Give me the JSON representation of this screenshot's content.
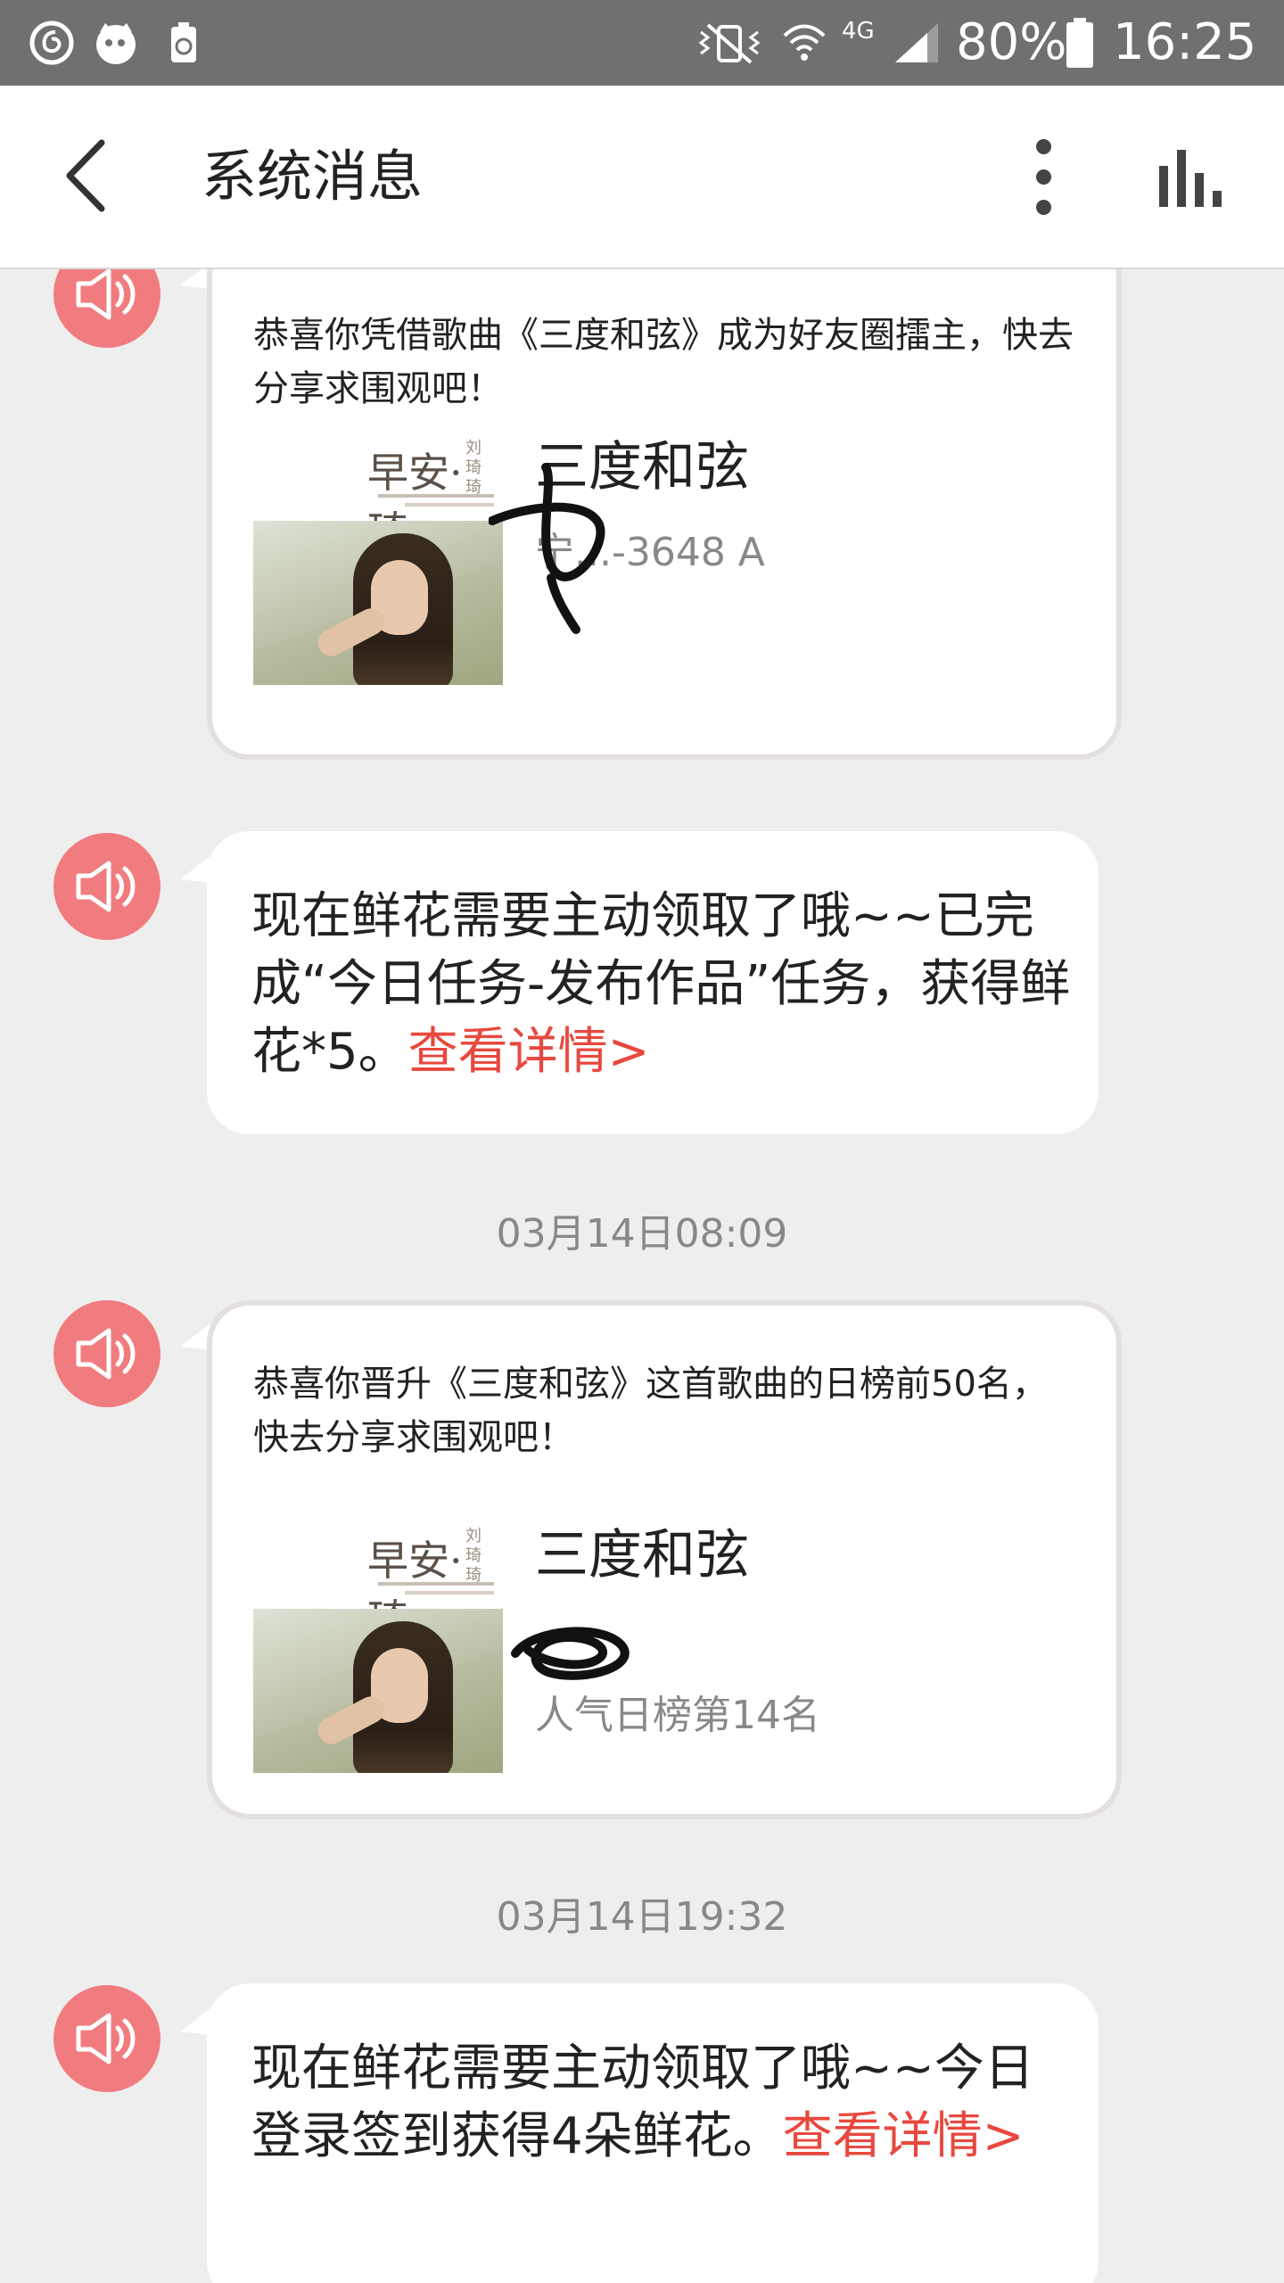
{
  "status_bar": {
    "battery_percent": "80%",
    "time": "16:25",
    "network_label": "4G",
    "left_icons": [
      "netease-music-icon",
      "cat-app-icon",
      "battery-saver-icon"
    ],
    "right_icons": [
      "mute-vibrate-icon",
      "wifi-icon",
      "cell-signal-icon",
      "battery-icon"
    ]
  },
  "header": {
    "title": "系统消息",
    "back_icon": "chevron-left-icon",
    "more_icon": "more-vertical-icon",
    "playing_icon": "equalizer-icon"
  },
  "messages": [
    {
      "type": "card",
      "text": "恭喜你凭借歌曲《三度和弦》成为好友圈擂主，快去分享求围观吧！",
      "song": {
        "cover_brand": "早安·琦",
        "cover_sub": "刘琦琦",
        "title": "三度和弦",
        "artist": "宁...-3648 A"
      }
    },
    {
      "type": "text",
      "text": "现在鲜花需要主动领取了哦~~已完成“今日任务-发布作品”任务，获得鲜花*5。",
      "link": "查看详情>"
    },
    {
      "type": "card",
      "timestamp": "03月14日08:09",
      "text": "恭喜你晋升《三度和弦》这首歌曲的日榜前50名，快去分享求围观吧！",
      "song": {
        "cover_brand": "早安·琦",
        "cover_sub": "刘琦琦",
        "title": "三度和弦",
        "rank": "人气日榜第14名"
      }
    },
    {
      "type": "text",
      "timestamp": "03月14日19:32",
      "text": "现在鲜花需要主动领取了哦~~今日登录签到获得4朵鲜花。",
      "link": "查看详情>"
    }
  ],
  "avatar_icon": "speaker-announcement-icon",
  "colors": {
    "accent": "#e8483e",
    "avatar": "#f07c80",
    "background": "#efeeef",
    "status_bar": "#707070"
  }
}
